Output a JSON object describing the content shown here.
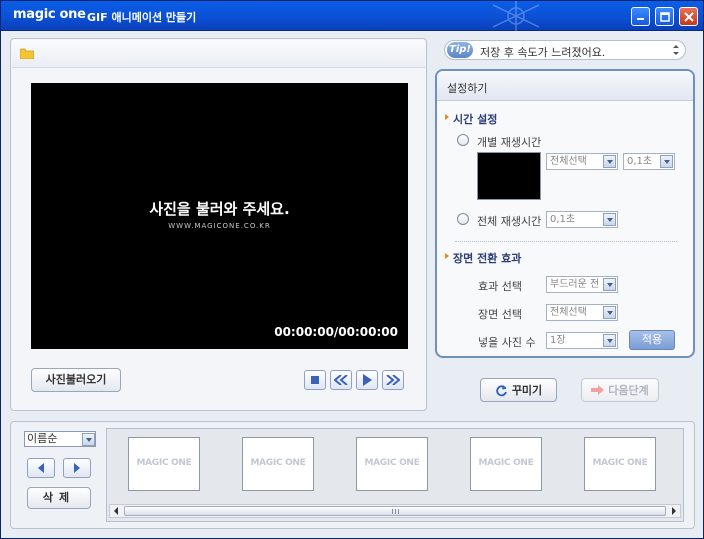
{
  "titlebar": {
    "brand": "magic one",
    "title": "GIF 애니메이션 만들기"
  },
  "preview": {
    "message": "사진을 불러와 주세요.",
    "url": "WWW.MAGICONE.CO.KR",
    "timecode": "00:00:00/00:00:00",
    "load_button": "사진불러오기"
  },
  "tip": {
    "badge": "Tip!",
    "text": "저장 후 속도가 느려졌어요."
  },
  "settings": {
    "title": "설정하기",
    "time_section": "시간 설정",
    "individual_label": "개별 재생시간",
    "individual_select": "전체선택",
    "individual_time": "0,1초",
    "all_label": "전체 재생시간",
    "all_time": "0,1초",
    "transition_section": "장면 전환 효과",
    "effect_label": "효과 선택",
    "effect_value": "부드러운 전",
    "scene_label": "장면 선택",
    "scene_value": "전체선택",
    "count_label": "넣을 사진 수",
    "count_value": "1장",
    "apply_button": "적용"
  },
  "actions": {
    "decorate": "꾸미기",
    "next": "다음단계"
  },
  "filmstrip": {
    "sort_value": "이름순",
    "delete_button": "삭제",
    "thumbnails": [
      "MAGIC ONE",
      "MAGIC ONE",
      "MAGIC ONE",
      "MAGIC ONE",
      "MAGIC ONE"
    ]
  },
  "colors": {
    "titlebar": "#0b4fd3",
    "panel_border": "#6f8fc1",
    "accent": "#e0871a"
  }
}
